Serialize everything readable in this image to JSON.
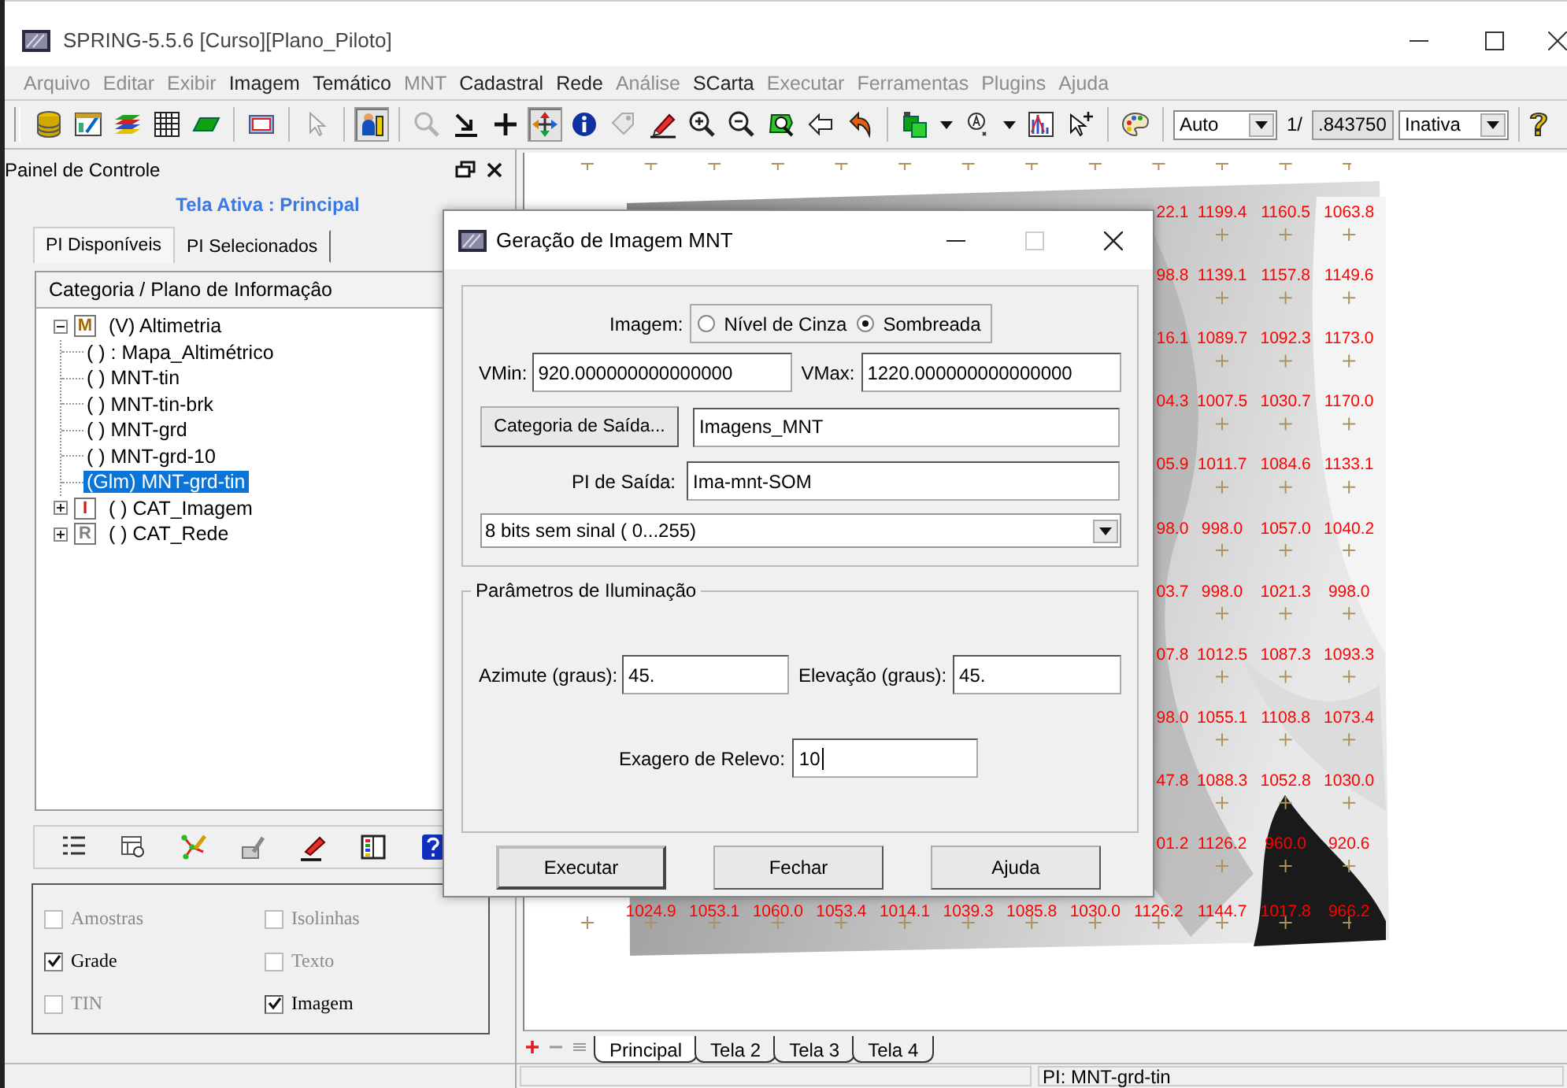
{
  "window": {
    "title": "SPRING-5.5.6 [Curso][Plano_Piloto]"
  },
  "menu": [
    {
      "label": "Arquivo",
      "disabled": true
    },
    {
      "label": "Editar",
      "disabled": true
    },
    {
      "label": "Exibir",
      "disabled": true
    },
    {
      "label": "Imagem",
      "disabled": false
    },
    {
      "label": "Temático",
      "disabled": false
    },
    {
      "label": "MNT",
      "disabled": true
    },
    {
      "label": "Cadastral",
      "disabled": false
    },
    {
      "label": "Rede",
      "disabled": false
    },
    {
      "label": "Análise",
      "disabled": true
    },
    {
      "label": "SCarta",
      "disabled": false
    },
    {
      "label": "Executar",
      "disabled": true
    },
    {
      "label": "Ferramentas",
      "disabled": true
    },
    {
      "label": "Plugins",
      "disabled": true
    },
    {
      "label": "Ajuda",
      "disabled": true
    }
  ],
  "toolbar": {
    "buttons": [
      {
        "pressed": false,
        "disabled": false
      },
      {
        "pressed": false,
        "disabled": false
      },
      {
        "pressed": false,
        "disabled": false
      },
      {
        "pressed": false,
        "disabled": false
      },
      {
        "pressed": false,
        "disabled": false
      },
      {
        "pressed": false,
        "disabled": false
      },
      {
        "pressed": false,
        "disabled": true
      },
      {
        "pressed": true,
        "disabled": false
      },
      {
        "pressed": false,
        "disabled": true
      },
      {
        "pressed": false,
        "disabled": false
      },
      {
        "pressed": false,
        "disabled": false
      },
      {
        "pressed": true,
        "disabled": false
      },
      {
        "pressed": false,
        "disabled": false
      },
      {
        "pressed": false,
        "disabled": true
      },
      {
        "pressed": false,
        "disabled": false
      },
      {
        "pressed": false,
        "disabled": false
      },
      {
        "pressed": false,
        "disabled": false
      },
      {
        "pressed": false,
        "disabled": false
      },
      {
        "pressed": false,
        "disabled": false
      },
      {
        "pressed": false,
        "disabled": false
      },
      {
        "pressed": false,
        "disabled": false
      },
      {
        "pressed": false,
        "disabled": false
      },
      {
        "pressed": false,
        "disabled": false
      },
      {
        "pressed": false,
        "disabled": false
      },
      {
        "pressed": false,
        "disabled": false
      }
    ],
    "scale_mode": "Auto",
    "scale_prefix": "1/",
    "scale_value": ".843750",
    "cursor_mode": "Inativa"
  },
  "control_panel": {
    "title": "Painel de Controle",
    "active_screen": "Tela Ativa : Principal",
    "tabs": [
      {
        "label": "PI Disponíveis",
        "selected": true
      },
      {
        "label": "PI Selecionados",
        "selected": false
      }
    ],
    "tree_header": "Categoria / Plano de Informaçâo",
    "tree": [
      {
        "badge": "M",
        "color": "#a06a00",
        "label": "(V) Altimetria",
        "expanded": true,
        "selected": false,
        "children": [
          {
            "label": "( ) : Mapa_Altimétrico",
            "selected": false
          },
          {
            "label": "( ) MNT-tin",
            "selected": false
          },
          {
            "label": "( ) MNT-tin-brk",
            "selected": false
          },
          {
            "label": "( ) MNT-grd",
            "selected": false
          },
          {
            "label": "( ) MNT-grd-10",
            "selected": false
          },
          {
            "label": "(Glm) MNT-grd-tin",
            "selected": true
          }
        ]
      },
      {
        "badge": "I",
        "color": "#e01010",
        "label": "( ) CAT_Imagem",
        "expanded": false,
        "selected": false
      },
      {
        "badge": "R",
        "color": "#808080",
        "label": "( ) CAT_Rede",
        "expanded": false,
        "selected": false
      }
    ],
    "layers": [
      {
        "label": "Amostras",
        "checked": false,
        "disabled": true
      },
      {
        "label": "Isolinhas",
        "checked": false,
        "disabled": true
      },
      {
        "label": "Grade",
        "checked": true,
        "disabled": false
      },
      {
        "label": "Texto",
        "checked": false,
        "disabled": true
      },
      {
        "label": "TIN",
        "checked": false,
        "disabled": true
      },
      {
        "label": "Imagem",
        "checked": true,
        "disabled": false
      }
    ]
  },
  "map": {
    "label_rows": [
      [
        "22.1",
        "1199.4",
        "1160.5",
        "1063.8"
      ],
      [
        "98.8",
        "1139.1",
        "1157.8",
        "1149.6"
      ],
      [
        "16.1",
        "1089.7",
        "1092.3",
        "1173.0"
      ],
      [
        "04.3",
        "1007.5",
        "1030.7",
        "1170.0"
      ],
      [
        "05.9",
        "1011.7",
        "1084.6",
        "1133.1"
      ],
      [
        "98.0",
        "998.0",
        "1057.0",
        "1040.2"
      ],
      [
        "03.7",
        "998.0",
        "1021.3",
        "998.0"
      ],
      [
        "07.8",
        "1012.5",
        "1087.3",
        "1093.3"
      ],
      [
        "98.0",
        "1055.1",
        "1108.8",
        "1073.4"
      ],
      [
        "47.8",
        "1088.3",
        "1052.8",
        "1030.0"
      ],
      [
        "01.2",
        "1126.2",
        "960.0",
        "920.6"
      ]
    ],
    "bottom_row": [
      "1024.9",
      "1053.1",
      "1060.0",
      "1053.4",
      "1014.1",
      "1039.3",
      "1085.8",
      "1030.0",
      "1126.2",
      "1144.7",
      "1017.8",
      "966.2"
    ]
  },
  "view_tabs": [
    {
      "label": "Principal",
      "selected": true
    },
    {
      "label": "Tela 2",
      "selected": false
    },
    {
      "label": "Tela 3",
      "selected": false
    },
    {
      "label": "Tela 4",
      "selected": false
    }
  ],
  "status_bar": {
    "pi": "PI: MNT-grd-tin"
  },
  "dialog": {
    "title": "Geração de Imagem MNT",
    "image_label": "Imagem:",
    "image_options": [
      {
        "label": "Nível de Cinza",
        "selected": false
      },
      {
        "label": "Sombreada",
        "selected": true
      }
    ],
    "vmin_label": "VMin:",
    "vmin": "920.000000000000000",
    "vmax_label": "VMax:",
    "vmax": "1220.000000000000000",
    "category_button": "Categoria de Saída...",
    "category": "Imagens_MNT",
    "pi_label": "PI de Saída:",
    "pi": "Ima-mnt-SOM",
    "format": "8 bits sem sinal ( 0...255)",
    "illumination_title": "Parâmetros de Iluminação",
    "azimuth_label": "Azimute (graus):",
    "azimuth": "45.",
    "elevation_label": "Elevação (graus):",
    "elevation": "45.",
    "exaggeration_label": "Exagero de Relevo:",
    "exaggeration": "10",
    "buttons": [
      {
        "label": "Executar",
        "default": true
      },
      {
        "label": "Fechar",
        "default": false
      },
      {
        "label": "Ajuda",
        "default": false
      }
    ]
  }
}
